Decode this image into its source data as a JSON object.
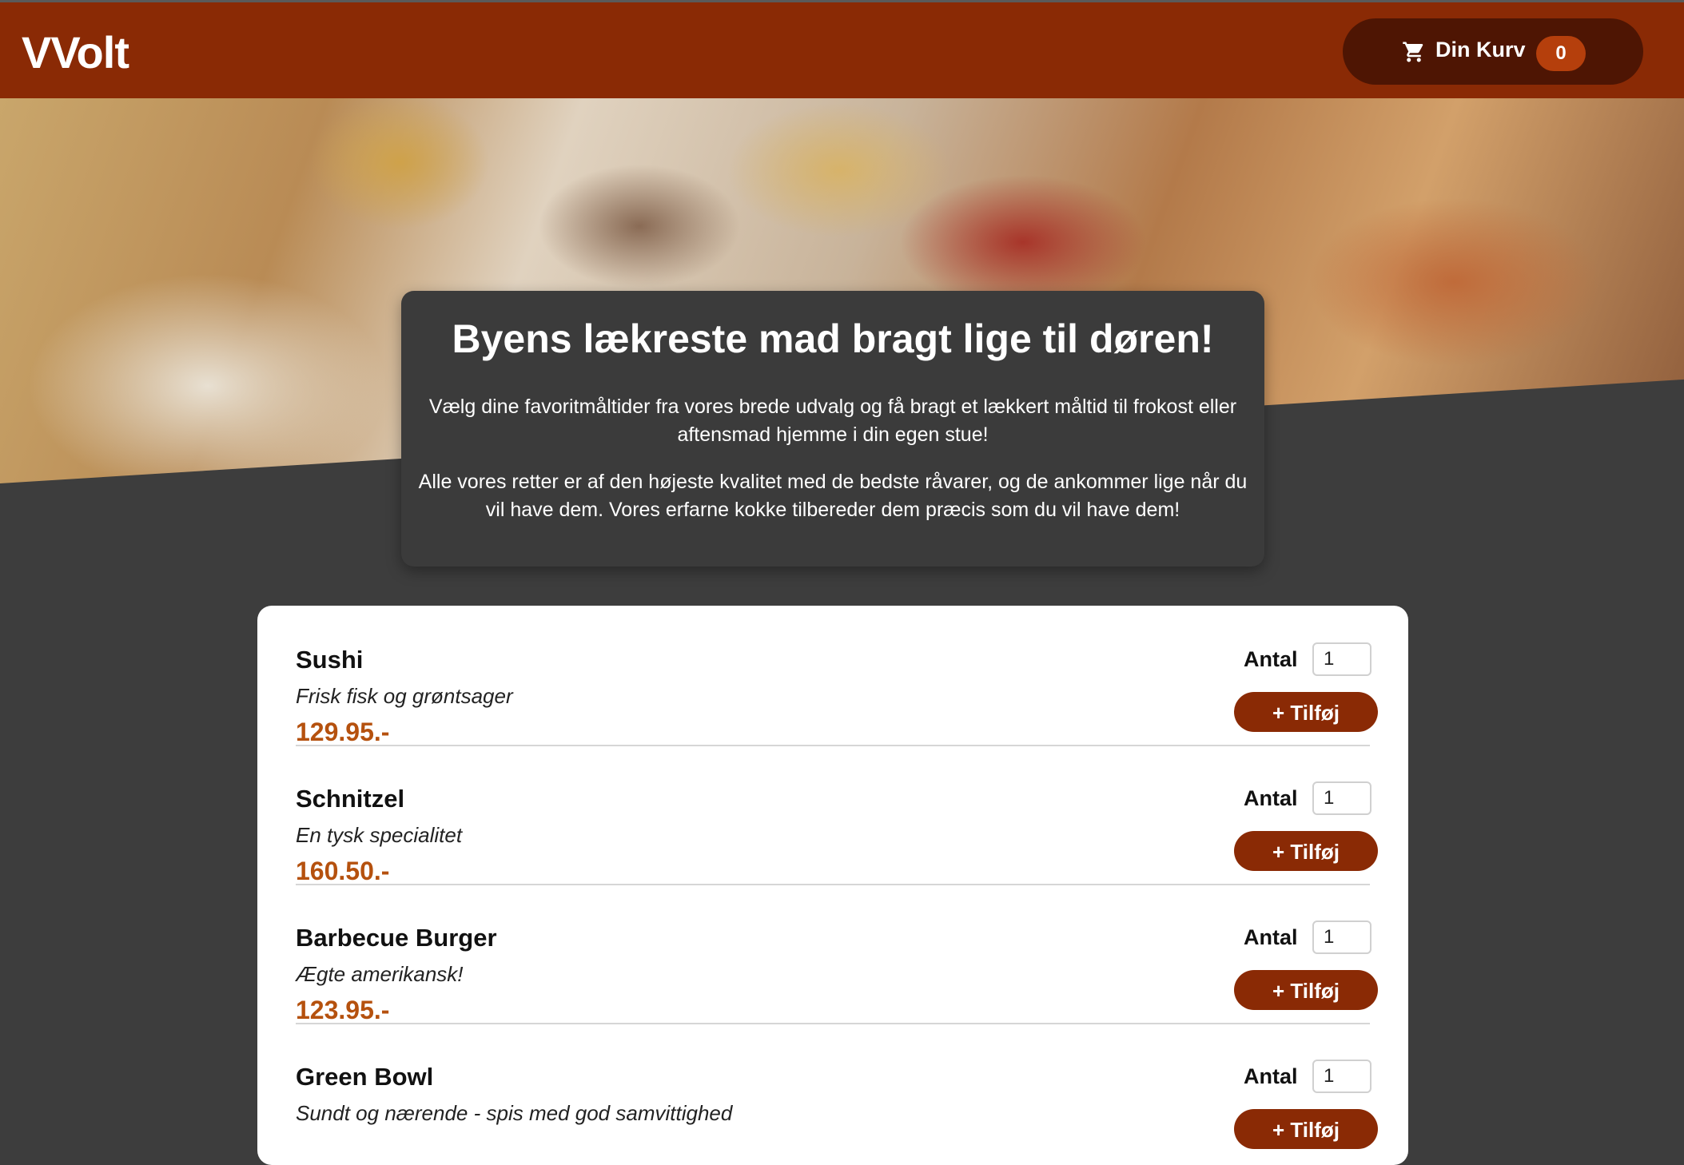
{
  "header": {
    "logo": "VVolt",
    "cart": {
      "label": "Din Kurv",
      "count": "0",
      "icon": "shopping-cart-icon"
    }
  },
  "hero": {
    "title": "Byens lækreste mad bragt lige til døren!",
    "paragraph1": "Vælg dine favoritmåltider fra vores brede udvalg og få bragt et lækkert måltid til frokost eller aftensmad hjemme i din egen stue!",
    "paragraph2": "Alle vores retter er af den højeste kvalitet med de bedste råvarer, og de ankommer lige når du vil have dem. Vores erfarne kokke tilbereder dem præcis som du vil have dem!"
  },
  "menu": {
    "qty_label": "Antal",
    "add_label": "+ Tilføj",
    "items": [
      {
        "name": "Sushi",
        "description": "Frisk fisk og grøntsager",
        "price": "129.95.-",
        "quantity": "1"
      },
      {
        "name": "Schnitzel",
        "description": "En tysk specialitet",
        "price": "160.50.-",
        "quantity": "1"
      },
      {
        "name": "Barbecue Burger",
        "description": "Ægte amerikansk!",
        "price": "123.95.-",
        "quantity": "1"
      },
      {
        "name": "Green Bowl",
        "description": "Sundt og nærende - spis med god samvittighed",
        "price": "",
        "quantity": "1"
      }
    ]
  },
  "colors": {
    "header": "#8a2a05",
    "cart_pill": "#4e1503",
    "cart_badge": "#b53f0c",
    "price": "#b5510e",
    "page_background": "#3d3d3d"
  }
}
